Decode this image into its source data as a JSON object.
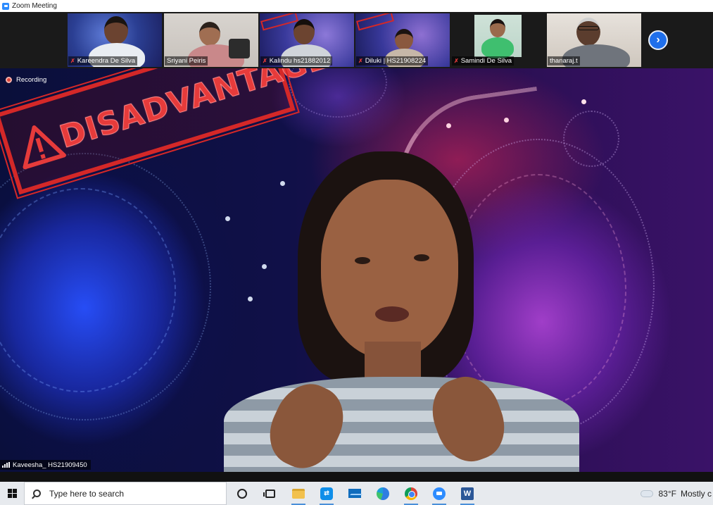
{
  "window": {
    "title": "Zoom Meeting"
  },
  "gallery": {
    "participants": [
      {
        "name": "Kareendra De Silva",
        "muted": true
      },
      {
        "name": "Sriyani Peiris",
        "muted": false
      },
      {
        "name": "Kalindu hs21882012",
        "muted": true
      },
      {
        "name": "Diluki | HS21908224",
        "muted": true
      },
      {
        "name": "Samindi De Silva",
        "muted": true
      },
      {
        "name": "thanaraj.t",
        "muted": false
      }
    ],
    "next_icon": "chevron-right-icon"
  },
  "main": {
    "recording_label": "Recording",
    "slide_stamp_text": "DISADVANTAGE",
    "speaker_name": "Kaveesha_ HS21909450"
  },
  "taskbar": {
    "search_placeholder": "Type here to search",
    "apps": [
      "cortana",
      "task-view",
      "file-explorer",
      "teamviewer",
      "mail",
      "edge",
      "chrome",
      "zoom",
      "word"
    ],
    "weather": {
      "temperature": "83°F",
      "description": "Mostly c"
    }
  },
  "colors": {
    "zoom_blue": "#2d8cff",
    "recording_red": "#e0453a",
    "stamp_red": "#d42828"
  }
}
